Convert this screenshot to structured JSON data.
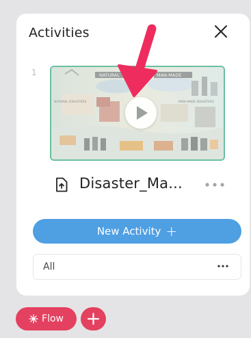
{
  "panel": {
    "title": "Activities",
    "close_icon": "close-icon",
    "items": [
      {
        "index": "1",
        "thumbnail": {
          "banner_left": "NATURAL",
          "banner_right": "MAN-MADE",
          "label_left": "NATURAL DISASTERS",
          "label_right": "MAN-MADE DISASTERS",
          "border_color": "#6bbf9e",
          "play_icon": "play-icon"
        },
        "file_icon": "file-upload-icon",
        "file_name": "Disaster_Ma...",
        "menu_icon": "more-horizontal-icon"
      }
    ],
    "new_activity": {
      "label": "New Activity",
      "icon": "plus-icon",
      "color": "#4f9fe3"
    },
    "filter": {
      "value": "All",
      "menu_icon": "more-horizontal-icon"
    }
  },
  "bottom_bar": {
    "flow": {
      "label": "Flow",
      "icon": "sparkle-icon",
      "color": "#e4405f"
    },
    "add": {
      "icon": "plus-icon",
      "color": "#e4405f"
    }
  },
  "annotation": {
    "arrow_color": "#ee2c5e"
  }
}
